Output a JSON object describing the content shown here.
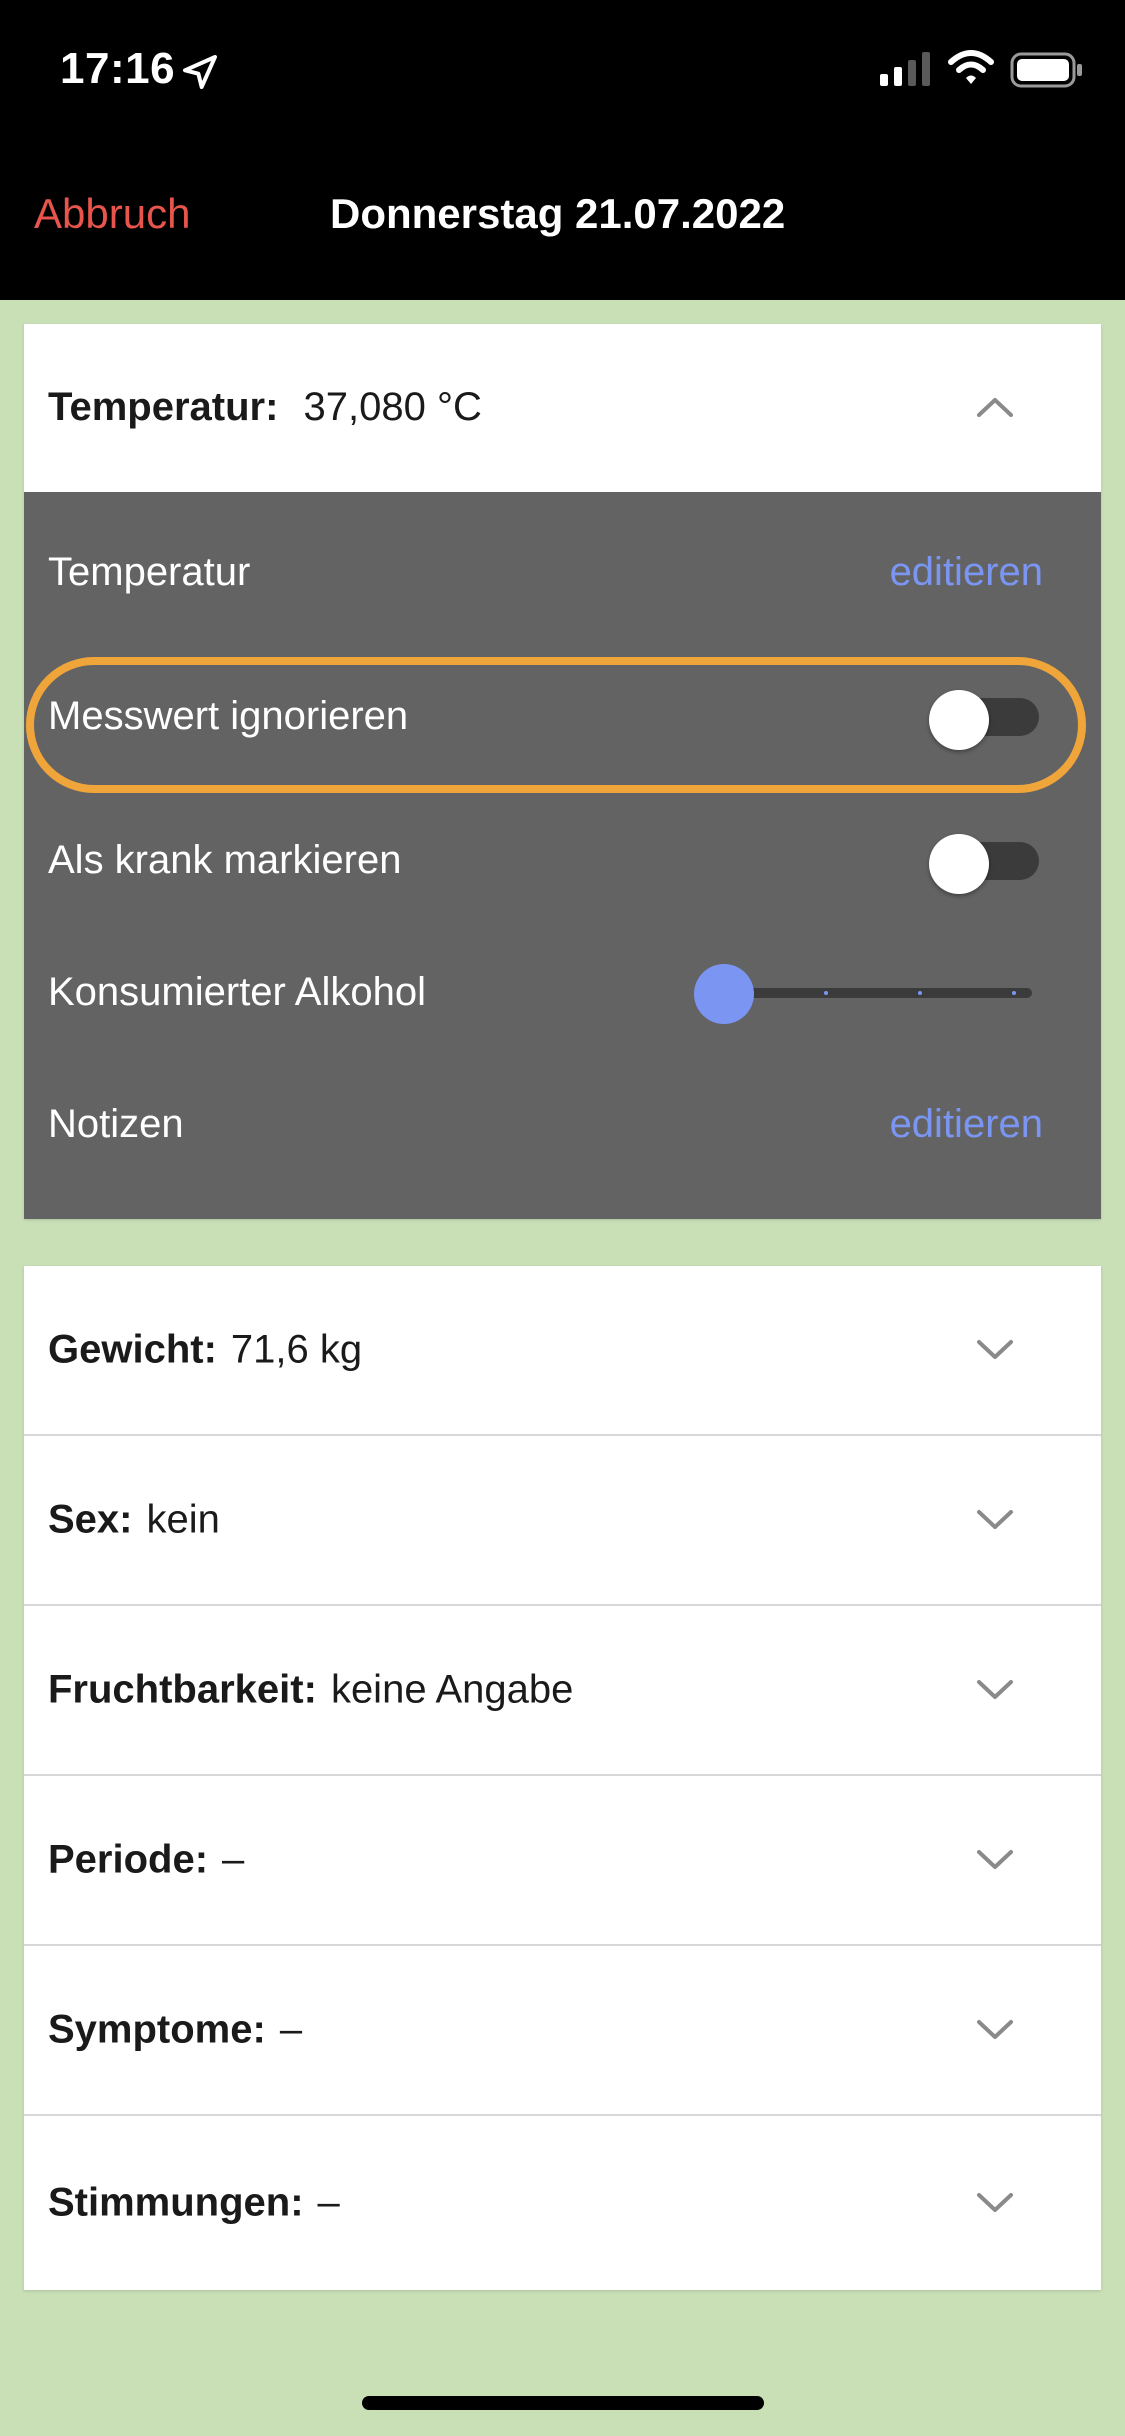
{
  "status_bar": {
    "time": "17:16"
  },
  "nav": {
    "cancel_label": "Abbruch",
    "title": "Donnerstag 21.07.2022"
  },
  "temperature_card": {
    "label": "Temperatur:",
    "value": "37,080 °C",
    "rows": {
      "temperature_label": "Temperatur",
      "temperature_action": "editieren",
      "ignore_label": "Messwert ignorieren",
      "ignore_on": false,
      "sick_label": "Als krank markieren",
      "sick_on": false,
      "alcohol_label": "Konsumierter Alkohol",
      "alcohol_level": 0,
      "notes_label": "Notizen",
      "notes_action": "editieren"
    }
  },
  "list": [
    {
      "label": "Gewicht:",
      "value": "71,6 kg"
    },
    {
      "label": "Sex:",
      "value": "kein"
    },
    {
      "label": "Fruchtbarkeit:",
      "value": "keine Angabe"
    },
    {
      "label": "Periode:",
      "value": "–"
    },
    {
      "label": "Symptome:",
      "value": "–"
    },
    {
      "label": "Stimmungen:",
      "value": "–"
    }
  ],
  "colors": {
    "background": "#c9e0b7",
    "accent_cancel": "#e8554c",
    "accent_link": "#7b96f2",
    "highlight": "#f0a53a",
    "panel": "#636363"
  }
}
